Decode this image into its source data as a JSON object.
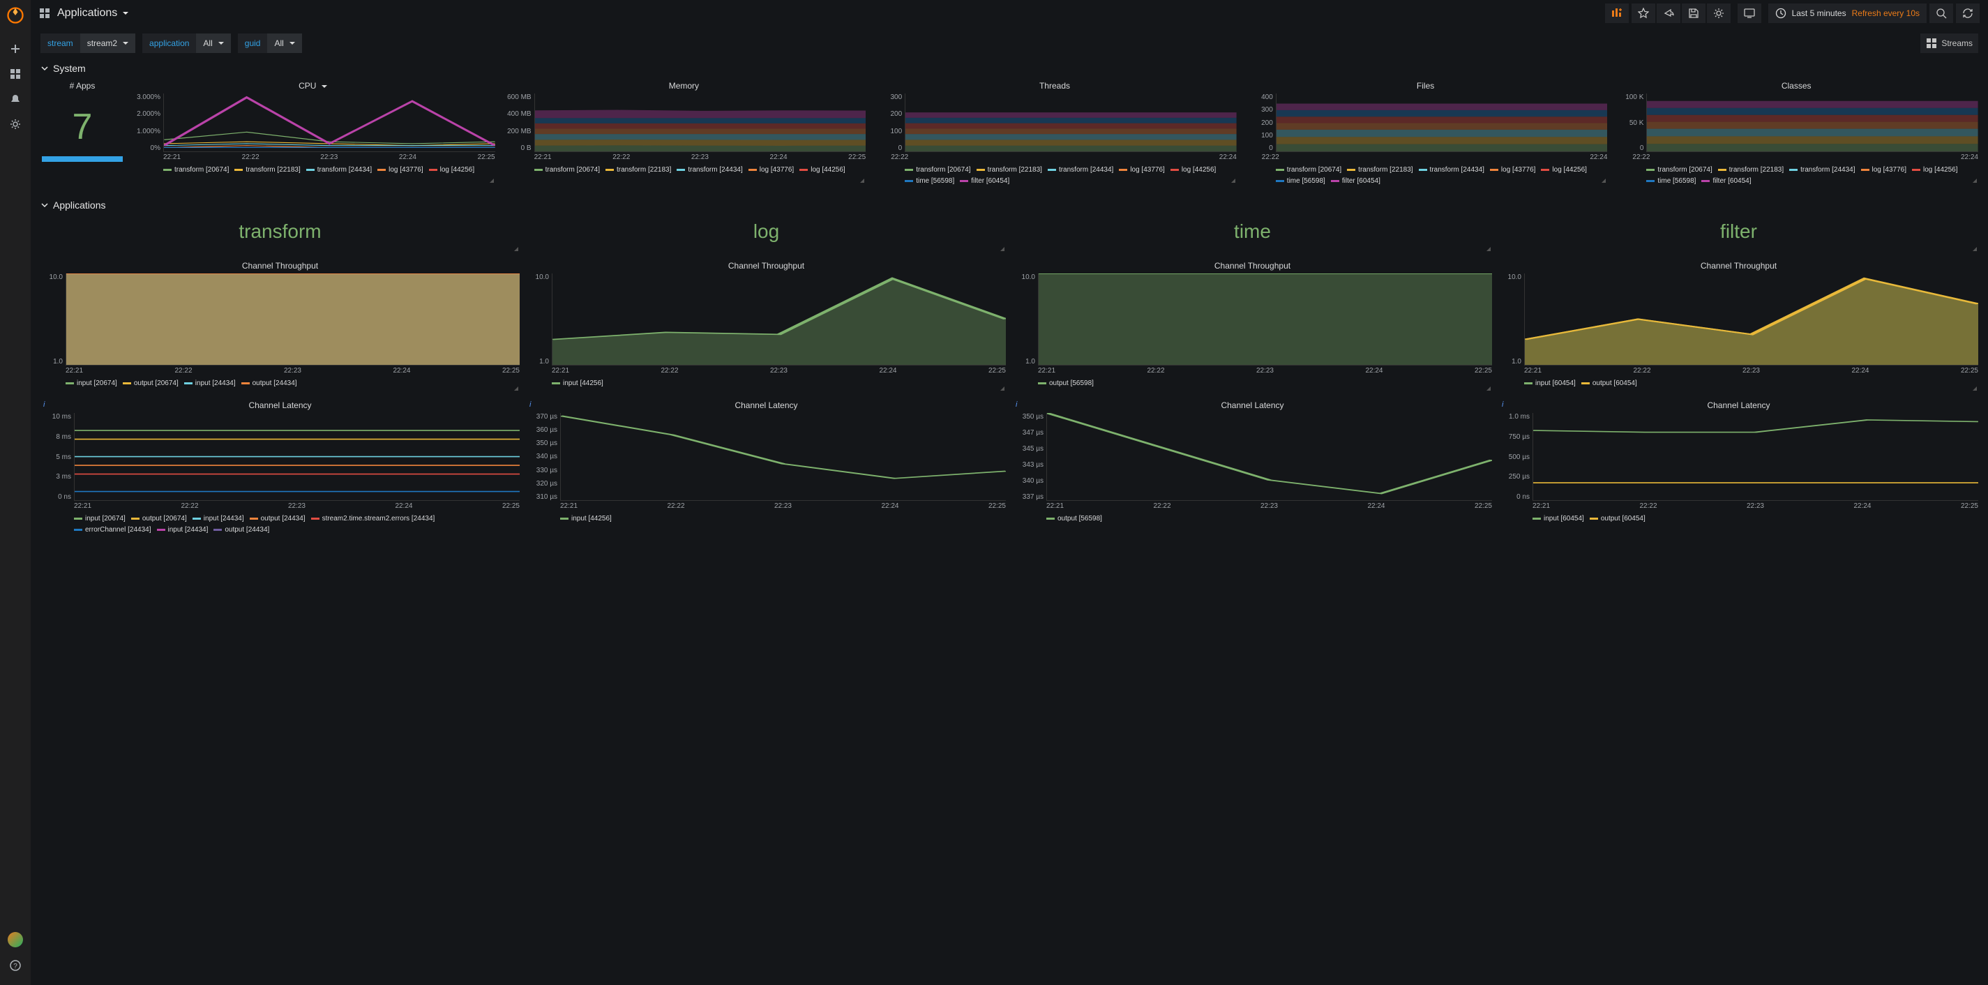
{
  "header": {
    "title": "Applications",
    "time_label": "Last 5 minutes",
    "refresh_label": "Refresh every 10s"
  },
  "variables": {
    "stream_label": "stream",
    "stream_value": "stream2",
    "application_label": "application",
    "application_value": "All",
    "guid_label": "guid",
    "guid_value": "All",
    "streams_button": "Streams"
  },
  "sections": [
    "System",
    "Applications"
  ],
  "system": {
    "apps_count_title": "# Apps",
    "apps_count": "7",
    "panels": [
      "CPU",
      "Memory",
      "Threads",
      "Files",
      "Classes"
    ],
    "time_axis": [
      "22:21",
      "22:22",
      "22:23",
      "22:24",
      "22:25"
    ],
    "time_axis_short": [
      "22:22",
      "22:24"
    ],
    "y_labels": {
      "cpu": [
        "3.000%",
        "2.000%",
        "1.000%",
        "0%"
      ],
      "memory": [
        "600 MB",
        "400 MB",
        "200 MB",
        "0 B"
      ],
      "threads": [
        "300",
        "200",
        "100",
        "0"
      ],
      "files": [
        "400",
        "300",
        "200",
        "100",
        "0"
      ],
      "classes": [
        "100 K",
        "50 K",
        "0"
      ]
    },
    "series_legend": [
      {
        "name": "transform [20674]",
        "color": "#7eb26d"
      },
      {
        "name": "transform [22183]",
        "color": "#eab839"
      },
      {
        "name": "transform [24434]",
        "color": "#6ed0e0"
      },
      {
        "name": "log [43776]",
        "color": "#ef843c"
      },
      {
        "name": "log [44256]",
        "color": "#e24d42"
      },
      {
        "name": "time [56598]",
        "color": "#1f78c1"
      },
      {
        "name": "filter [60454]",
        "color": "#ba43a9"
      }
    ]
  },
  "apps": [
    "transform",
    "log",
    "time",
    "filter"
  ],
  "throughput_title": "Channel Throughput",
  "latency_title": "Channel Latency",
  "throughput": {
    "y": [
      "10.0",
      "1.0"
    ],
    "x": [
      "22:21",
      "22:22",
      "22:23",
      "22:24",
      "22:25"
    ],
    "legends": {
      "transform": [
        {
          "name": "input [20674]",
          "color": "#7eb26d"
        },
        {
          "name": "output [20674]",
          "color": "#eab839"
        },
        {
          "name": "input [24434]",
          "color": "#6ed0e0"
        },
        {
          "name": "output [24434]",
          "color": "#ef843c"
        }
      ],
      "log": [
        {
          "name": "input [44256]",
          "color": "#7eb26d"
        }
      ],
      "time": [
        {
          "name": "output [56598]",
          "color": "#7eb26d"
        }
      ],
      "filter": [
        {
          "name": "input [60454]",
          "color": "#7eb26d"
        },
        {
          "name": "output [60454]",
          "color": "#eab839"
        }
      ]
    }
  },
  "latency": {
    "x": [
      "22:21",
      "22:22",
      "22:23",
      "22:24",
      "22:25"
    ],
    "y_labels": {
      "transform": [
        "10 ms",
        "8 ms",
        "5 ms",
        "3 ms",
        "0 ns"
      ],
      "log": [
        "370 µs",
        "360 µs",
        "350 µs",
        "340 µs",
        "330 µs",
        "320 µs",
        "310 µs"
      ],
      "time": [
        "350 µs",
        "347 µs",
        "345 µs",
        "343 µs",
        "340 µs",
        "337 µs"
      ],
      "filter": [
        "1.0 ms",
        "750 µs",
        "500 µs",
        "250 µs",
        "0 ns"
      ]
    },
    "legends": {
      "transform": [
        {
          "name": "input [20674]",
          "color": "#7eb26d"
        },
        {
          "name": "output [20674]",
          "color": "#eab839"
        },
        {
          "name": "input [24434]",
          "color": "#6ed0e0"
        },
        {
          "name": "output [24434]",
          "color": "#ef843c"
        },
        {
          "name": "stream2.time.stream2.errors [24434]",
          "color": "#e24d42"
        },
        {
          "name": "errorChannel [24434]",
          "color": "#1f78c1"
        },
        {
          "name": "input [24434]",
          "color": "#ba43a9"
        },
        {
          "name": "output [24434]",
          "color": "#705da0"
        }
      ],
      "log": [
        {
          "name": "input [44256]",
          "color": "#7eb26d"
        }
      ],
      "time": [
        {
          "name": "output [56598]",
          "color": "#7eb26d"
        }
      ],
      "filter": [
        {
          "name": "input [60454]",
          "color": "#7eb26d"
        },
        {
          "name": "output [60454]",
          "color": "#eab839"
        }
      ]
    }
  },
  "chart_data": [
    {
      "type": "line",
      "title": "CPU",
      "xlabel": "",
      "ylabel": "%",
      "ylim": [
        0,
        3
      ],
      "x": [
        "22:21",
        "22:22",
        "22:23",
        "22:24",
        "22:25"
      ],
      "series": [
        {
          "name": "transform [20674]",
          "values": [
            0.6,
            1.0,
            0.5,
            0.4,
            0.5
          ]
        },
        {
          "name": "transform [22183]",
          "values": [
            0.4,
            0.5,
            0.4,
            0.3,
            0.4
          ]
        },
        {
          "name": "transform [24434]",
          "values": [
            0.3,
            0.4,
            0.3,
            0.3,
            0.3
          ]
        },
        {
          "name": "log [43776]",
          "values": [
            0.2,
            0.3,
            0.2,
            0.2,
            0.2
          ]
        },
        {
          "name": "log [44256]",
          "values": [
            0.2,
            0.2,
            0.2,
            0.2,
            0.2
          ]
        },
        {
          "name": "time [56598]",
          "values": [
            0.2,
            0.2,
            0.2,
            0.2,
            0.2
          ]
        },
        {
          "name": "filter [60454]",
          "values": [
            0.3,
            2.8,
            0.4,
            2.6,
            0.3
          ]
        }
      ]
    },
    {
      "type": "area",
      "title": "Memory",
      "xlabel": "",
      "ylabel": "MB",
      "ylim": [
        0,
        600
      ],
      "x": [
        "22:21",
        "22:22",
        "22:23",
        "22:24",
        "22:25"
      ],
      "series": [
        {
          "name": "transform [20674]",
          "values": [
            60,
            62,
            60,
            58,
            60
          ]
        },
        {
          "name": "transform [22183]",
          "values": [
            60,
            60,
            60,
            60,
            60
          ]
        },
        {
          "name": "transform [24434]",
          "values": [
            60,
            58,
            60,
            62,
            60
          ]
        },
        {
          "name": "log [43776]",
          "values": [
            55,
            55,
            55,
            55,
            55
          ]
        },
        {
          "name": "log [44256]",
          "values": [
            55,
            55,
            55,
            55,
            55
          ]
        },
        {
          "name": "time [56598]",
          "values": [
            55,
            55,
            55,
            55,
            55
          ]
        },
        {
          "name": "filter [60454]",
          "values": [
            80,
            85,
            75,
            80,
            78
          ]
        }
      ]
    },
    {
      "type": "area",
      "title": "Threads",
      "ylim": [
        0,
        300
      ],
      "x": [
        "22:22",
        "22:24"
      ],
      "series": [
        {
          "name": "transform [20674]",
          "values": [
            30,
            30
          ]
        },
        {
          "name": "transform [22183]",
          "values": [
            30,
            30
          ]
        },
        {
          "name": "transform [24434]",
          "values": [
            30,
            30
          ]
        },
        {
          "name": "log [43776]",
          "values": [
            28,
            28
          ]
        },
        {
          "name": "log [44256]",
          "values": [
            28,
            28
          ]
        },
        {
          "name": "time [56598]",
          "values": [
            28,
            28
          ]
        },
        {
          "name": "filter [60454]",
          "values": [
            28,
            28
          ]
        }
      ]
    },
    {
      "type": "area",
      "title": "Files",
      "ylim": [
        0,
        400
      ],
      "x": [
        "22:22",
        "22:24"
      ],
      "series": [
        {
          "name": "transform [20674]",
          "values": [
            50,
            50
          ]
        },
        {
          "name": "transform [22183]",
          "values": [
            50,
            50
          ]
        },
        {
          "name": "transform [24434]",
          "values": [
            50,
            50
          ]
        },
        {
          "name": "log [43776]",
          "values": [
            45,
            45
          ]
        },
        {
          "name": "log [44256]",
          "values": [
            45,
            45
          ]
        },
        {
          "name": "time [56598]",
          "values": [
            45,
            45
          ]
        },
        {
          "name": "filter [60454]",
          "values": [
            45,
            45
          ]
        }
      ]
    },
    {
      "type": "area",
      "title": "Classes",
      "ylim": [
        0,
        100000
      ],
      "x": [
        "22:22",
        "22:24"
      ],
      "series": [
        {
          "name": "transform [20674]",
          "values": [
            13000,
            13000
          ]
        },
        {
          "name": "transform [22183]",
          "values": [
            13000,
            13000
          ]
        },
        {
          "name": "transform [24434]",
          "values": [
            13000,
            13000
          ]
        },
        {
          "name": "log [43776]",
          "values": [
            12000,
            12000
          ]
        },
        {
          "name": "log [44256]",
          "values": [
            12000,
            12000
          ]
        },
        {
          "name": "time [56598]",
          "values": [
            12000,
            12000
          ]
        },
        {
          "name": "filter [60454]",
          "values": [
            12000,
            12000
          ]
        }
      ]
    },
    {
      "type": "line",
      "title": "Channel Throughput – transform",
      "ylim": [
        1,
        10
      ],
      "x": [
        "22:21",
        "22:22",
        "22:23",
        "22:24",
        "22:25"
      ],
      "series": [
        {
          "name": "input [20674]",
          "values": [
            10,
            10,
            10,
            10,
            10
          ]
        },
        {
          "name": "output [20674]",
          "values": [
            10,
            10,
            10,
            10,
            10
          ]
        },
        {
          "name": "input [24434]",
          "values": [
            10,
            10,
            10,
            10,
            10
          ]
        },
        {
          "name": "output [24434]",
          "values": [
            10,
            10,
            10,
            10,
            10
          ]
        }
      ]
    },
    {
      "type": "line",
      "title": "Channel Throughput – log",
      "ylim": [
        1,
        10
      ],
      "x": [
        "22:21",
        "22:22",
        "22:23",
        "22:24",
        "22:25"
      ],
      "series": [
        {
          "name": "input [44256]",
          "values": [
            3.5,
            4.2,
            4.0,
            9.5,
            5.5
          ]
        }
      ]
    },
    {
      "type": "line",
      "title": "Channel Throughput – time",
      "ylim": [
        1,
        10
      ],
      "x": [
        "22:21",
        "22:22",
        "22:23",
        "22:24",
        "22:25"
      ],
      "series": [
        {
          "name": "output [56598]",
          "values": [
            10,
            10,
            10,
            10,
            10
          ]
        }
      ]
    },
    {
      "type": "line",
      "title": "Channel Throughput – filter",
      "ylim": [
        1,
        10
      ],
      "x": [
        "22:21",
        "22:22",
        "22:23",
        "22:24",
        "22:25"
      ],
      "series": [
        {
          "name": "input [60454]",
          "values": [
            3.5,
            5.5,
            4.0,
            9.5,
            7.0
          ]
        },
        {
          "name": "output [60454]",
          "values": [
            3.5,
            5.5,
            4.0,
            9.5,
            7.0
          ]
        }
      ]
    },
    {
      "type": "line",
      "title": "Channel Latency – transform",
      "ylim": [
        0,
        10
      ],
      "yunit": "ms",
      "x": [
        "22:21",
        "22:22",
        "22:23",
        "22:24",
        "22:25"
      ],
      "series": [
        {
          "name": "input [20674]",
          "values": [
            8,
            8,
            8,
            8,
            8
          ]
        },
        {
          "name": "output [20674]",
          "values": [
            7,
            7,
            7,
            7,
            7
          ]
        },
        {
          "name": "input [24434]",
          "values": [
            5,
            5,
            5,
            5,
            5
          ]
        },
        {
          "name": "output [24434]",
          "values": [
            4,
            4,
            4,
            4,
            4
          ]
        },
        {
          "name": "stream2.time.stream2.errors [24434]",
          "values": [
            3,
            3,
            3,
            3,
            3
          ]
        },
        {
          "name": "errorChannel [24434]",
          "values": [
            1,
            1,
            1,
            1,
            1
          ]
        }
      ]
    },
    {
      "type": "line",
      "title": "Channel Latency – log",
      "ylim": [
        310,
        370
      ],
      "yunit": "µs",
      "x": [
        "22:21",
        "22:22",
        "22:23",
        "22:24",
        "22:25"
      ],
      "series": [
        {
          "name": "input [44256]",
          "values": [
            368,
            355,
            335,
            325,
            330
          ]
        }
      ]
    },
    {
      "type": "line",
      "title": "Channel Latency – time",
      "ylim": [
        337,
        350
      ],
      "yunit": "µs",
      "x": [
        "22:21",
        "22:22",
        "22:23",
        "22:24",
        "22:25"
      ],
      "series": [
        {
          "name": "output [56598]",
          "values": [
            350,
            345,
            340,
            338,
            343
          ]
        }
      ]
    },
    {
      "type": "line",
      "title": "Channel Latency – filter",
      "ylim": [
        0,
        1000
      ],
      "yunit": "µs",
      "x": [
        "22:21",
        "22:22",
        "22:23",
        "22:24",
        "22:25"
      ],
      "series": [
        {
          "name": "input [60454]",
          "values": [
            800,
            780,
            780,
            920,
            900
          ]
        },
        {
          "name": "output [60454]",
          "values": [
            200,
            200,
            200,
            200,
            200
          ]
        }
      ]
    }
  ]
}
